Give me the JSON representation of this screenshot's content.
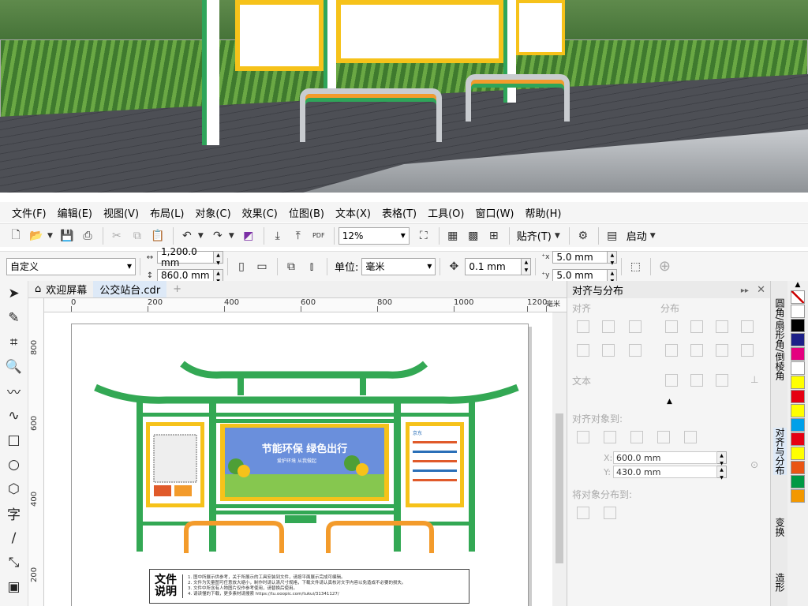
{
  "menu": [
    {
      "label": "文件(F)"
    },
    {
      "label": "编辑(E)"
    },
    {
      "label": "视图(V)"
    },
    {
      "label": "布局(L)"
    },
    {
      "label": "对象(C)"
    },
    {
      "label": "效果(C)"
    },
    {
      "label": "位图(B)"
    },
    {
      "label": "文本(X)"
    },
    {
      "label": "表格(T)"
    },
    {
      "label": "工具(O)"
    },
    {
      "label": "窗口(W)"
    },
    {
      "label": "帮助(H)"
    }
  ],
  "toolbar1": {
    "pdf_label": "PDF",
    "zoom_value": "12%",
    "snap_label": "贴齐(T)",
    "launch_label": "启动"
  },
  "toolbar2": {
    "page_preset": "自定义",
    "width": "1,200.0 mm",
    "height": "860.0 mm",
    "unit_label": "单位:",
    "unit_value": "毫米",
    "nudge": "0.1 mm",
    "dup_x": "5.0 mm",
    "dup_y": "5.0 mm"
  },
  "doc_tabs": [
    {
      "label": "欢迎屏幕",
      "icon": "home-icon"
    },
    {
      "label": "公交站台.cdr"
    }
  ],
  "ruler": {
    "h_ticks": [
      "0",
      "200",
      "400",
      "600",
      "800",
      "1000",
      "1200"
    ],
    "h_unit": "毫米",
    "v_ticks": [
      "800",
      "600",
      "400",
      "200"
    ]
  },
  "canvas": {
    "headline": "节能环保 绿色出行",
    "subline": "爱护环境 从我做起",
    "poster_side_title": "京东",
    "note_title": "文件说明",
    "note_lines": [
      "1. 图中所展示供参考，关于所展示的工具安装到文件，请按平面展示完成可编辑。",
      "2. 文件为矢量图可任意放大缩小，制作时请认清尺寸规格，下载文件请认真核对文字内容以免造成不必要的损失。",
      "3. 文件中所含有人物图片仅作参考使用，请替换后使用。",
      "4. 请读懂的下载，更多素材请搜索 https://tu.ooopic.com/tukui/31341127/"
    ]
  },
  "docker": {
    "title": "对齐与分布",
    "section_align": "对齐",
    "section_distribute": "分布",
    "section_text": "文本",
    "section_align_to": "对齐对象到:",
    "x_label": "X:",
    "x_value": "600.0 mm",
    "y_label": "Y:",
    "y_value": "430.0 mm",
    "section_distribute_to": "将对象分布到:"
  },
  "side_tabs": [
    "圆角/扇形角/倒棱角",
    "对齐与分布",
    "变换",
    "造形"
  ],
  "palette": [
    "#ffffff",
    "#000000",
    "#1d2088",
    "#e4007f",
    "#ffffff",
    "#ffff00",
    "#e60012",
    "#ffff00",
    "#00a0e9",
    "#e60012",
    "#ffff00",
    "#ea5514",
    "#009944",
    "#f39800"
  ]
}
